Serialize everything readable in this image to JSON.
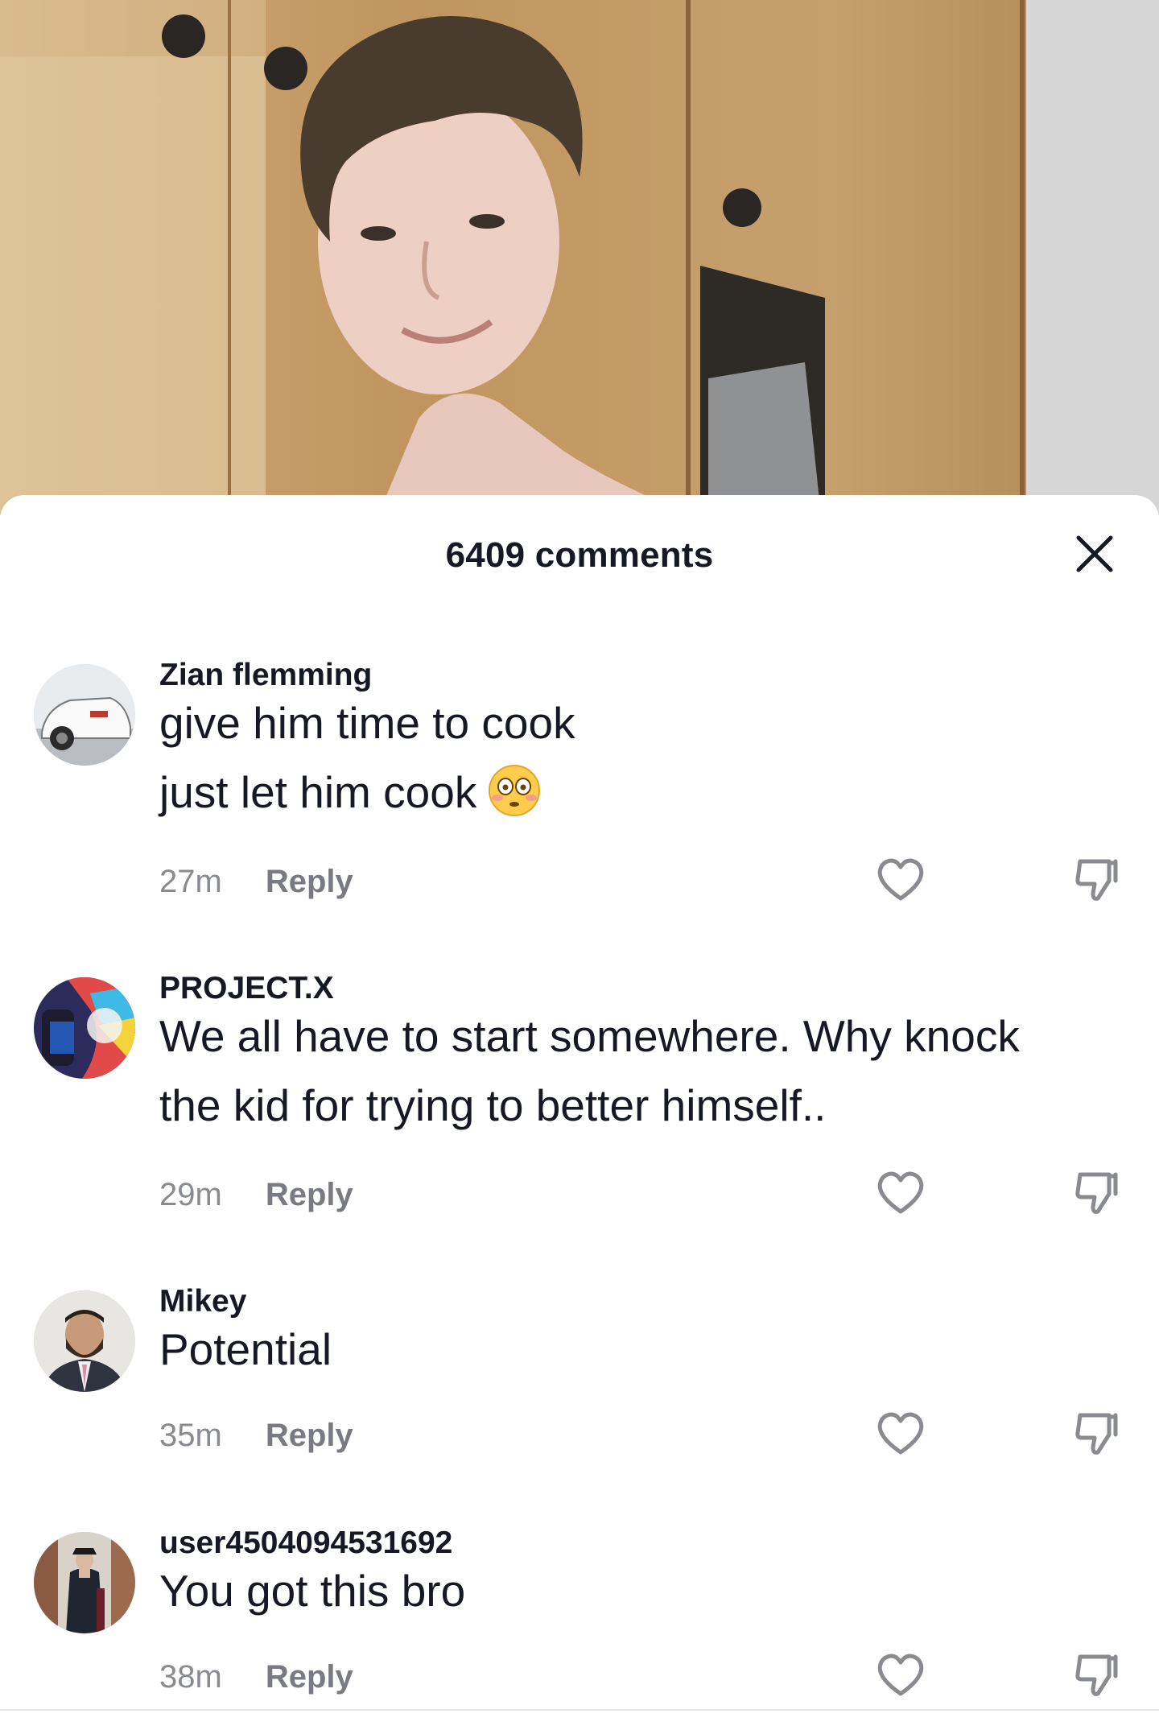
{
  "header": {
    "title": "6409 comments",
    "close_icon": "close-icon"
  },
  "comments": [
    {
      "username": "Zian flemming",
      "lines": [
        "give him time to cook",
        "just let him cook"
      ],
      "emoji": "flushed-face-emoji",
      "time": "27m",
      "reply_label": "Reply"
    },
    {
      "username": "PROJECT.X",
      "lines": [
        "We all have to start somewhere. Why knock",
        "the kid for trying to better himself.."
      ],
      "time": "29m",
      "reply_label": "Reply"
    },
    {
      "username": "Mikey",
      "lines": [
        "Potential"
      ],
      "time": "35m",
      "reply_label": "Reply"
    },
    {
      "username": "user4504094531692",
      "lines": [
        "You got this bro"
      ],
      "time": "38m",
      "reply_label": "Reply"
    }
  ],
  "colors": {
    "text_primary": "#161823",
    "text_secondary": "#8a8b91",
    "sheet_background": "#ffffff"
  }
}
